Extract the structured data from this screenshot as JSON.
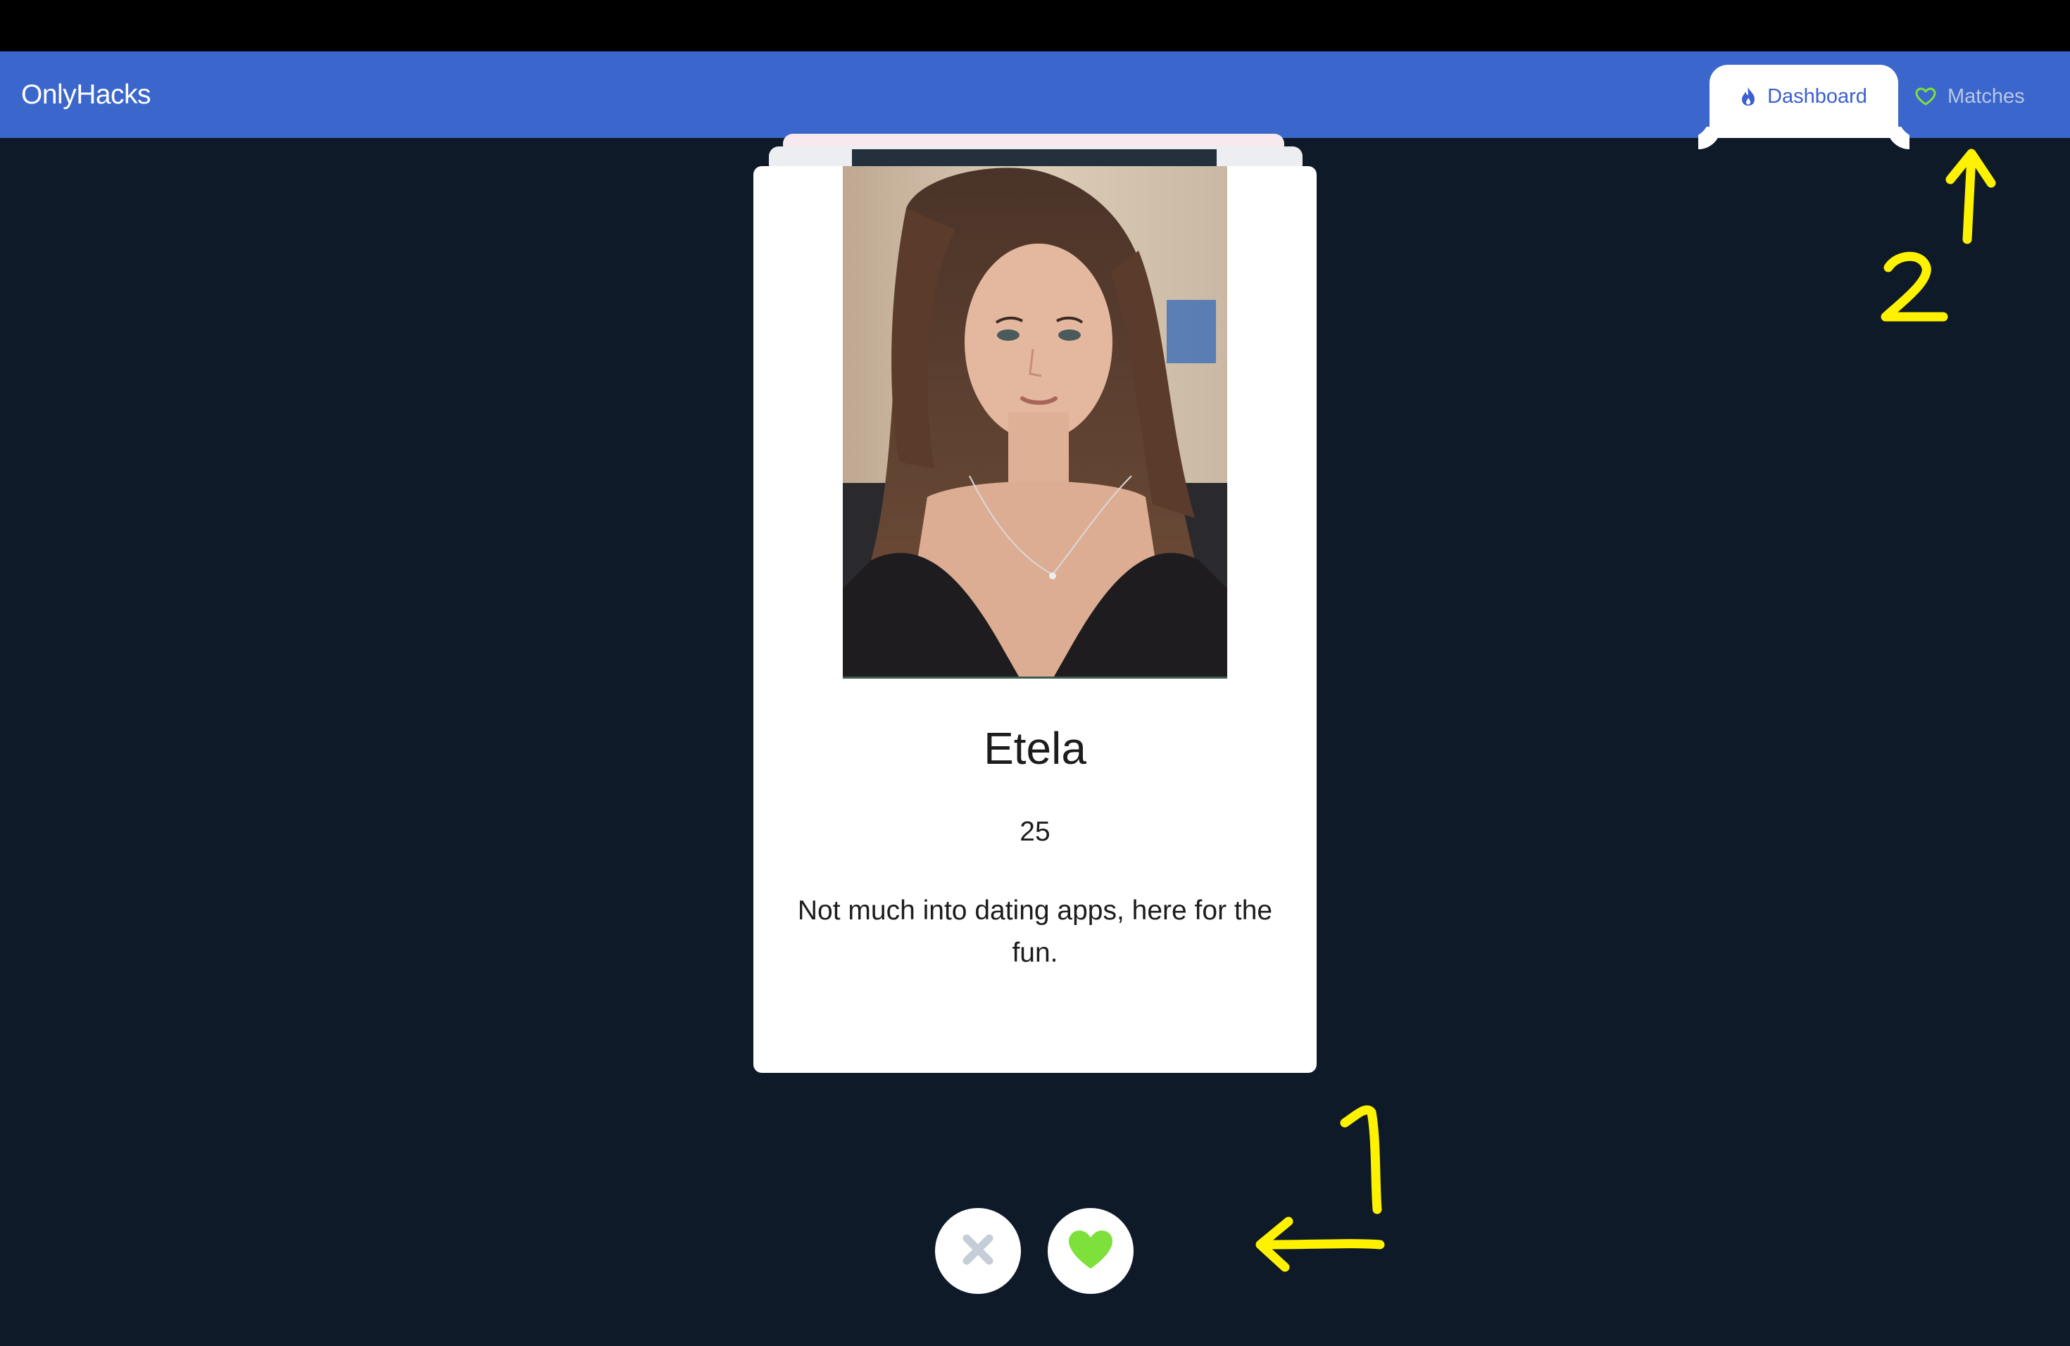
{
  "app": {
    "brand": "OnlyHacks"
  },
  "nav": {
    "tabs": [
      {
        "label": "Dashboard",
        "icon": "flame-icon",
        "active": true
      },
      {
        "label": "Matches",
        "icon": "heart-outline-icon",
        "active": false
      }
    ]
  },
  "profile_card": {
    "name": "Etela",
    "age": "25",
    "bio": "Not much into dating apps, here for the fun."
  },
  "actions": {
    "dislike_icon": "close-icon",
    "like_icon": "heart-icon"
  },
  "annotations": [
    {
      "label": "1",
      "target": "like/dislike buttons"
    },
    {
      "label": "2",
      "target": "Matches tab"
    }
  ],
  "colors": {
    "navbar": "#3b67cc",
    "background": "#0f1a28",
    "like_green": "#7ee03a",
    "dislike_gray": "#c5ced8",
    "annotation_yellow": "#fff200"
  }
}
